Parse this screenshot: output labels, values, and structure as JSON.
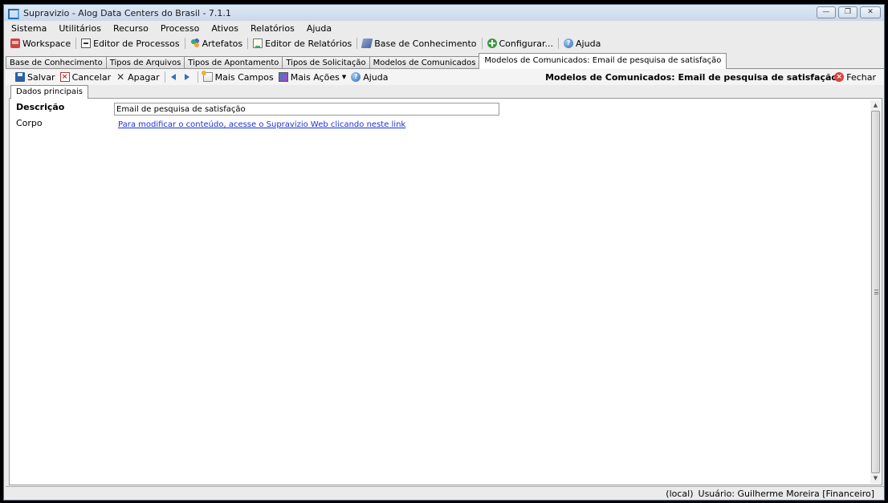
{
  "window": {
    "title": "Supravizio - Alog Data Centers do Brasil - 7.1.1",
    "controls": [
      "minimize",
      "restore",
      "close"
    ]
  },
  "menu": [
    "Sistema",
    "Utilitários",
    "Recurso",
    "Processo",
    "Ativos",
    "Relatórios",
    "Ajuda"
  ],
  "toolbar": {
    "items": [
      {
        "label": "Workspace",
        "icon": "workspace-icon"
      },
      {
        "label": "Editor de Processos",
        "icon": "process-editor-icon"
      },
      {
        "label": "Artefatos",
        "icon": "artifacts-icon"
      },
      {
        "label": "Editor de Relatórios",
        "icon": "report-editor-icon"
      },
      {
        "label": "Base de Conhecimento",
        "icon": "knowledge-base-icon"
      },
      {
        "label": "Configurar...",
        "icon": "add-icon"
      },
      {
        "label": "Ajuda",
        "icon": "help-icon"
      }
    ]
  },
  "doc_tabs": [
    "Base de Conhecimento",
    "Tipos de Arquivos",
    "Tipos de Apontamento",
    "Tipos de Solicitação",
    "Modelos de Comunicados",
    "Modelos de Comunicados: Email de pesquisa de satisfação"
  ],
  "actions": {
    "save": "Salvar",
    "cancel": "Cancelar",
    "delete": "Apagar",
    "more_fields": "Mais Campos",
    "more_actions": "Mais Ações",
    "help": "Ajuda",
    "header_title": "Modelos de Comunicados: Email de pesquisa de satisfação",
    "close": "Fechar"
  },
  "inner_tab": "Dados principais",
  "form": {
    "description_label": "Descrição",
    "description_value": "Email de pesquisa de satisfação",
    "body_label": "Corpo",
    "body_link": "Para modificar o conteúdo, acesse o Supravizio Web clicando neste link"
  },
  "status": {
    "server": "(local)",
    "user": "Usuário: Guilherme Moreira [Financeiro]"
  }
}
